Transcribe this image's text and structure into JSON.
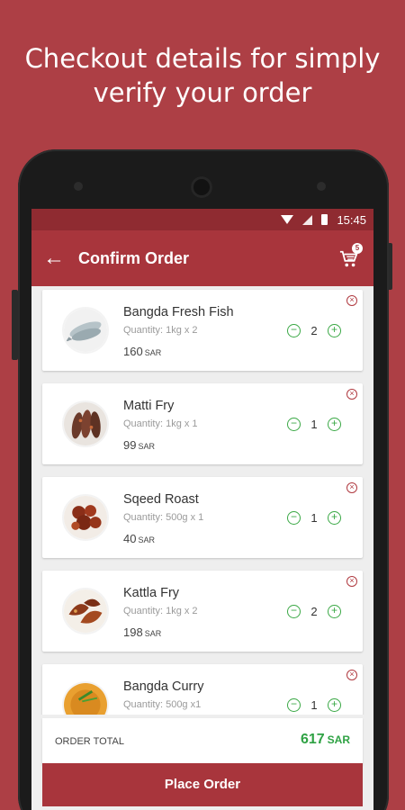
{
  "promo": {
    "line1": "Checkout details for simply",
    "line2": "verify your order"
  },
  "statusbar": {
    "time": "15:45"
  },
  "toolbar": {
    "back_icon": "arrow-left-icon",
    "title": "Confirm Order",
    "cart_icon": "cart-icon",
    "cart_count": "5"
  },
  "items": [
    {
      "name": "Bangda Fresh Fish",
      "quantity": "Quantity:  1kg x 2",
      "price": "160",
      "currency": "SAR",
      "count": "2",
      "image": "fish-image"
    },
    {
      "name": "Matti Fry",
      "quantity": "Quantity:  1kg x 1",
      "price": "99",
      "currency": "SAR",
      "count": "1",
      "image": "fried-fish-image"
    },
    {
      "name": "Sqeed Roast",
      "quantity": "Quantity:  500g x 1",
      "price": "40",
      "currency": "SAR",
      "count": "1",
      "image": "squid-roast-image"
    },
    {
      "name": "Kattla Fry",
      "quantity": "Quantity:  1kg x 2",
      "price": "198",
      "currency": "SAR",
      "count": "2",
      "image": "kattla-fry-image"
    },
    {
      "name": "Bangda Curry",
      "quantity": "Quantity:  500g x1",
      "price": "",
      "currency": "",
      "count": "1",
      "image": "curry-image"
    }
  ],
  "order_total": {
    "label": "ORDER TOTAL",
    "value": "617",
    "currency": "SAR"
  },
  "place_order": {
    "label": "Place Order"
  },
  "colors": {
    "background": "#ad3f45",
    "toolbar": "#a8353c",
    "statusbar": "#8f2b31",
    "accent_green": "#3aa845",
    "remove_red": "#b03a40"
  }
}
